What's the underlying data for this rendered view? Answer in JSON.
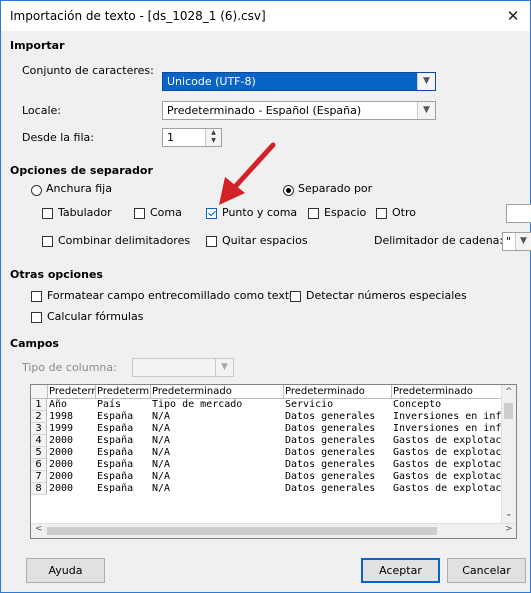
{
  "window": {
    "title": "Importación de texto - [ds_1028_1 (6).csv]",
    "close_glyph": "✕"
  },
  "import": {
    "section": "Importar",
    "charset_label": "Conjunto de caracteres:",
    "charset_value": "Unicode (UTF-8)",
    "locale_label": "Locale:",
    "locale_value": "Predeterminado - Español (España)",
    "from_row_label": "Desde la fila:",
    "from_row_value": "1"
  },
  "separator": {
    "section": "Opciones de separador",
    "fixed_width": "Anchura fija",
    "separated_by": "Separado por",
    "tab": "Tabulador",
    "comma": "Coma",
    "semicolon": "Punto y coma",
    "space": "Espacio",
    "other": "Otro",
    "merge": "Combinar delimitadores",
    "trim": "Quitar espacios",
    "string_delim_label": "Delimitador de cadena:",
    "string_delim_value": "\""
  },
  "other_options": {
    "section": "Otras opciones",
    "quoted_as_text": "Formatear campo entrecomillado como texto",
    "detect_numbers": "Detectar números especiales",
    "evaluate_formulas": "Calcular fórmulas"
  },
  "fields": {
    "section": "Campos",
    "column_type_label": "Tipo de columna:",
    "headers": [
      "Predeterm",
      "Predeterm",
      "Predeterminado",
      "Predeterminado",
      "Predeterminado"
    ],
    "row_numbers": [
      "1",
      "2",
      "3",
      "4",
      "5",
      "6",
      "7",
      "8"
    ],
    "rows": [
      [
        "Año",
        "País",
        "Tipo de mercado",
        "Servicio",
        "Concepto"
      ],
      [
        "1998",
        "España",
        "N/A",
        "Datos generales",
        "Inversiones en inf"
      ],
      [
        "1999",
        "España",
        "N/A",
        "Datos generales",
        "Inversiones en inf"
      ],
      [
        "2000",
        "España",
        "N/A",
        "Datos generales",
        "Gastos de explotac"
      ],
      [
        "2000",
        "España",
        "N/A",
        "Datos generales",
        "Gastos de explotac"
      ],
      [
        "2000",
        "España",
        "N/A",
        "Datos generales",
        "Gastos de explotac"
      ],
      [
        "2000",
        "España",
        "N/A",
        "Datos generales",
        "Gastos de explotac"
      ],
      [
        "2000",
        "España",
        "N/A",
        "Datos generales",
        "Gastos de explotac"
      ]
    ]
  },
  "buttons": {
    "help": "Ayuda",
    "ok": "Aceptar",
    "cancel": "Cancelar"
  },
  "colors": {
    "selection": "#0a64c8",
    "arrow": "#d42027"
  }
}
